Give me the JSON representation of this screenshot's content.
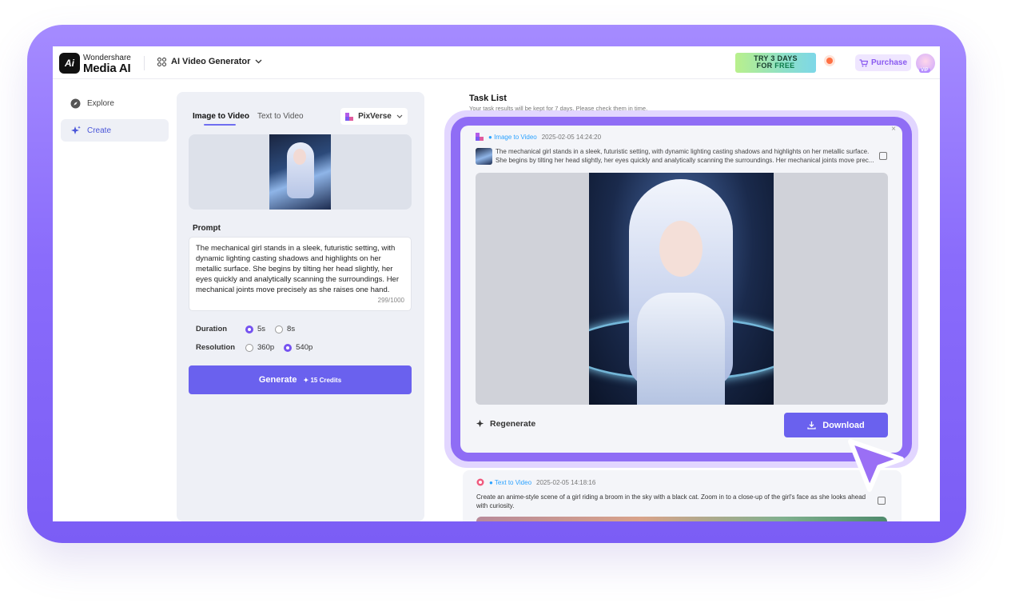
{
  "brand": {
    "line1": "Wondershare",
    "line2": "Media AI",
    "mark": "Ai"
  },
  "app_selector": {
    "label": "AI Video Generator"
  },
  "promo": {
    "line1": "TRY 3 DAYS",
    "line2a": "FOR ",
    "line2b": "FREE"
  },
  "purchase": {
    "label": "Purchase"
  },
  "vip": {
    "label": "VIP"
  },
  "sidebar": {
    "items": [
      {
        "label": "Explore",
        "icon": "compass-icon",
        "active": false
      },
      {
        "label": "Create",
        "icon": "sparkle-icon",
        "active": true
      }
    ]
  },
  "panel": {
    "tabs": [
      {
        "label": "Image to Video",
        "active": true
      },
      {
        "label": "Text to Video",
        "active": false
      }
    ],
    "model": "PixVerse",
    "prompt_label": "Prompt",
    "prompt_text": "The mechanical girl stands in a sleek, futuristic setting, with dynamic lighting casting shadows and highlights on her metallic surface. She begins by tilting her head slightly, her eyes quickly and analytically scanning the surroundings. Her mechanical joints move precisely as she raises one hand.",
    "char_count": "299/1000",
    "duration": {
      "label": "Duration",
      "options": [
        "5s",
        "8s"
      ],
      "selected": "5s"
    },
    "resolution": {
      "label": "Resolution",
      "options": [
        "360p",
        "540p"
      ],
      "selected": "540p"
    },
    "generate": {
      "label": "Generate",
      "credits": "15 Credits"
    }
  },
  "tasks": {
    "title": "Task List",
    "subtitle": "Your task results will be kept for 7 days. Please check them in time.",
    "items": [
      {
        "type": "Image to Video",
        "time": "2025-02-05 14:24:20",
        "prompt": "The mechanical girl stands in a sleek, futuristic setting, with dynamic lighting casting shadows and highlights on her metallic surface. She begins by tilting her head slightly, her eyes quickly and analytically scanning the surroundings. Her mechanical joints move prec...",
        "regenerate": "Regenerate",
        "download": "Download"
      },
      {
        "type": "Text to Video",
        "time": "2025-02-05 14:18:16",
        "prompt": "Create an anime-style scene of a girl riding a broom in the sky with a black cat. Zoom in to a close-up of the girl's face as she looks ahead with curiosity."
      }
    ]
  },
  "colors": {
    "accent": "#6a61ee",
    "frame": "#8a6cfb",
    "link": "#2ba2ff"
  }
}
